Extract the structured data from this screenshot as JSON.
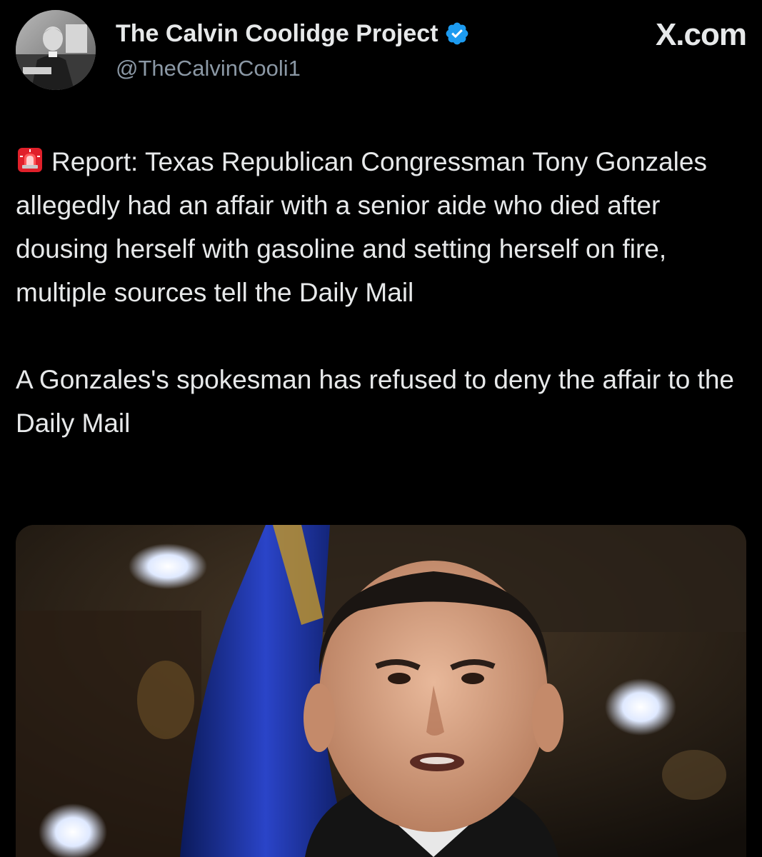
{
  "author": {
    "name": "The Calvin Coolidge Project",
    "handle": "@TheCalvinCooli1",
    "verified": true,
    "verified_color": "#1d9bf0"
  },
  "site": {
    "brand": "X.com"
  },
  "post": {
    "lead_icon": "police-siren-icon",
    "paragraphs": [
      "Report: Texas Republican Congressman Tony Gonzales allegedly had an affair with a senior aide who died after dousing herself with gasoline and setting herself on fire, multiple sources tell the Daily Mail",
      "A Gonzales's spokesman has refused to deny the affair to the Daily Mail"
    ]
  },
  "colors": {
    "background": "#000000",
    "text_primary": "#e7e9ea",
    "text_secondary": "#8b98a5"
  }
}
